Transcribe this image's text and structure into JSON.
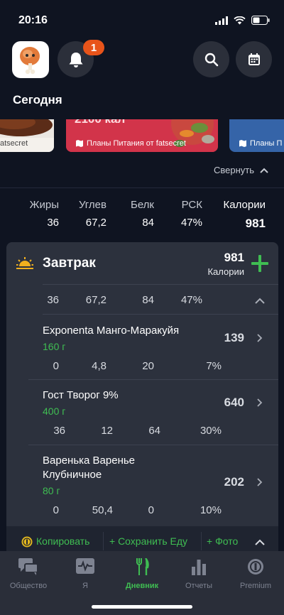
{
  "status": {
    "time": "20:16"
  },
  "header": {
    "notification_count": "1",
    "today_label": "Сегодня"
  },
  "carousel": {
    "card1_caption": "atsecret",
    "card2_title": "2100 кал",
    "card2_caption": "Планы Питания от fatsecret",
    "card3_caption": "Планы П"
  },
  "collapse_label": "Свернуть",
  "summary": {
    "labels": [
      "Жиры",
      "Углев",
      "Белк",
      "РСК",
      "Калории"
    ],
    "values": [
      "36",
      "67,2",
      "84",
      "47%",
      "981"
    ]
  },
  "meal": {
    "title": "Завтрак",
    "calories": "981",
    "calories_label": "Калории",
    "totals": [
      "36",
      "67,2",
      "84",
      "47%"
    ],
    "items": [
      {
        "name": "Exponenta Манго-Маракуйя",
        "amount": "160 г",
        "calories": "139",
        "nutrients": [
          "0",
          "4,8",
          "20",
          "7%"
        ]
      },
      {
        "name": "Гост Творог 9%",
        "amount": "400 г",
        "calories": "640",
        "nutrients": [
          "36",
          "12",
          "64",
          "30%"
        ]
      },
      {
        "name_line1": "Варенька  Варенье",
        "name_line2": "Клубничное",
        "amount": "80 г",
        "calories": "202",
        "nutrients": [
          "0",
          "50,4",
          "0",
          "10%"
        ]
      }
    ],
    "actions": {
      "copy": "Копировать",
      "save": "+ Сохранить Еду",
      "photo": "+ Фото"
    }
  },
  "tabs": [
    {
      "label": "Общество",
      "icon": "chat-icon"
    },
    {
      "label": "Я",
      "icon": "heart-pulse-icon"
    },
    {
      "label": "Дневник",
      "icon": "fork-knife-icon",
      "active": true
    },
    {
      "label": "Отчеты",
      "icon": "bar-chart-icon"
    },
    {
      "label": "Premium",
      "icon": "premium-badge-icon"
    }
  ],
  "colors": {
    "accent_green": "#3fbd52",
    "badge_orange": "#e8541a",
    "background": "#0f1421",
    "card": "#2c313d"
  }
}
